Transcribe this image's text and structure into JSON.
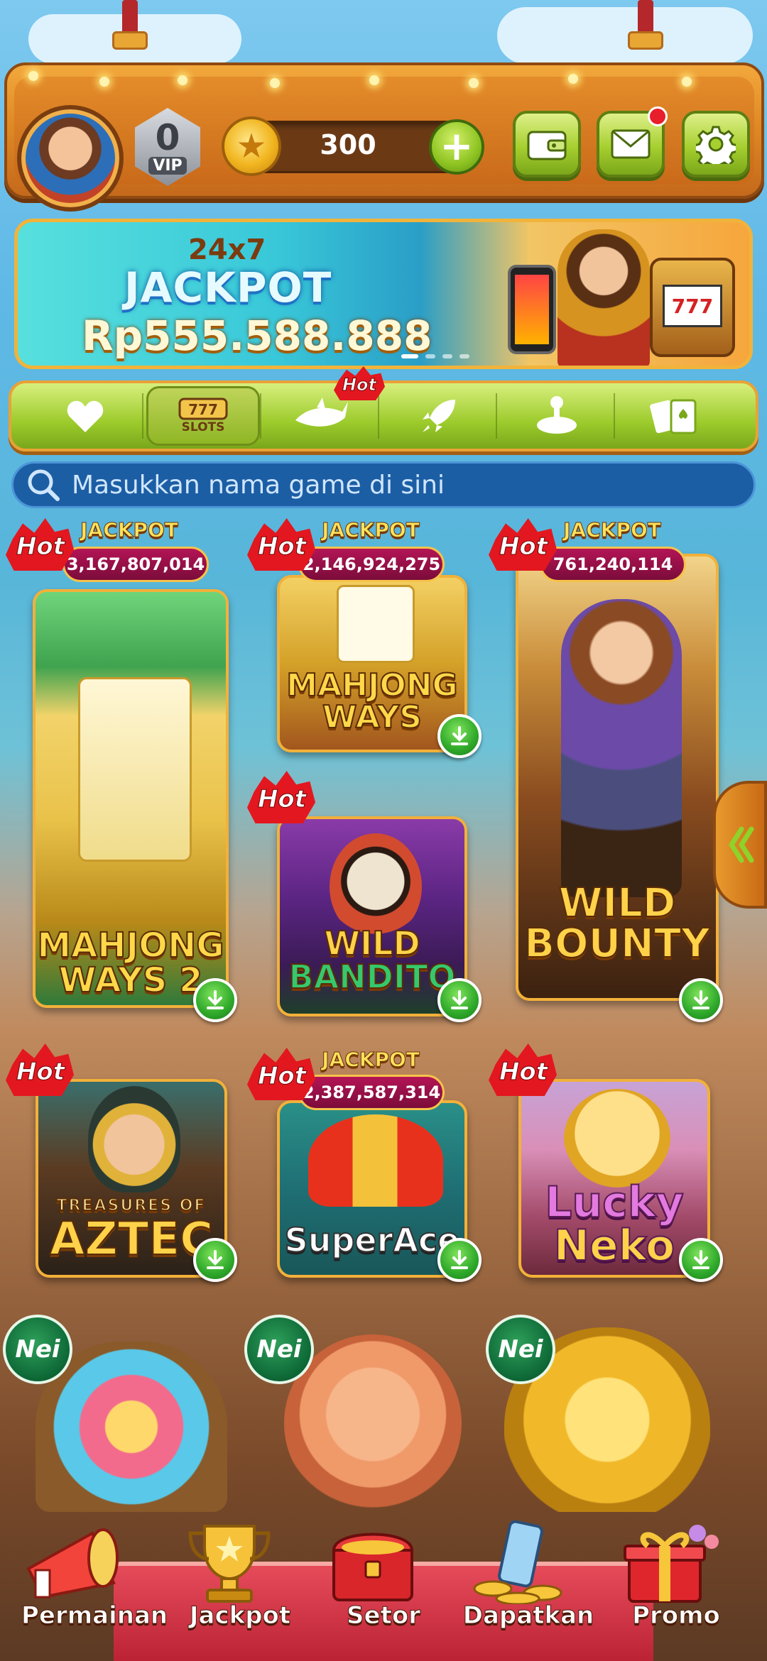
{
  "header": {
    "vip_level": "0",
    "vip_label": "VIP",
    "coins": "300"
  },
  "banner": {
    "line1": "24x7",
    "line2": "JACKPOT",
    "amount": "Rp555.588.888",
    "machine_text": "777"
  },
  "categories": [
    {
      "icon": "heart-icon",
      "label": ""
    },
    {
      "icon": "slots-icon",
      "label": "SLOTS",
      "reel_text": "777"
    },
    {
      "icon": "shark-icon",
      "label": "",
      "badge": "Hot"
    },
    {
      "icon": "rocket-icon",
      "label": ""
    },
    {
      "icon": "arcade-icon",
      "label": ""
    },
    {
      "icon": "cards-icon",
      "label": ""
    }
  ],
  "search": {
    "placeholder": "Masukkan nama game di sini"
  },
  "badges": {
    "hot": "Hot",
    "new": "Nei",
    "jackpot": "JACKPOT"
  },
  "games": [
    {
      "title_line1": "MAHJONG",
      "title_line2": "WAYS 2",
      "jackpot": "3,167,807,014",
      "badge": "Hot"
    },
    {
      "title_line1": "MAHJONG",
      "title_line2": "WAYS",
      "jackpot": "2,146,924,275",
      "badge": "Hot"
    },
    {
      "title_line1": "WILD",
      "title_line2": "BOUNTY",
      "jackpot": "761,240,114",
      "badge": "Hot"
    },
    {
      "title_line1": "WILD",
      "title_line2": "BANDITO",
      "badge": "Hot"
    },
    {
      "title_line1": "TREASURES OF",
      "title_line2": "AZTEC",
      "badge": "Hot"
    },
    {
      "title_line1": "SuperAce",
      "title_line2": "",
      "jackpot": "2,387,587,314",
      "badge": "Hot"
    },
    {
      "title_line1": "Lucky",
      "title_line2": "Neko",
      "badge": "Hot"
    }
  ],
  "bottom_nav": [
    {
      "label": "Permainan",
      "icon": "megaphone-icon"
    },
    {
      "label": "Jackpot",
      "icon": "trophy-icon"
    },
    {
      "label": "Setor",
      "icon": "treasure-chest-icon"
    },
    {
      "label": "Dapatkan",
      "icon": "phone-coins-icon"
    },
    {
      "label": "Promo",
      "icon": "gift-icon"
    }
  ],
  "colors": {
    "top_bar": "#e08a25",
    "green_button": "#a6cf2f",
    "search_bg": "#1c5ea4",
    "hot_red": "#e3171f",
    "jackpot_pill": "#b31455"
  }
}
